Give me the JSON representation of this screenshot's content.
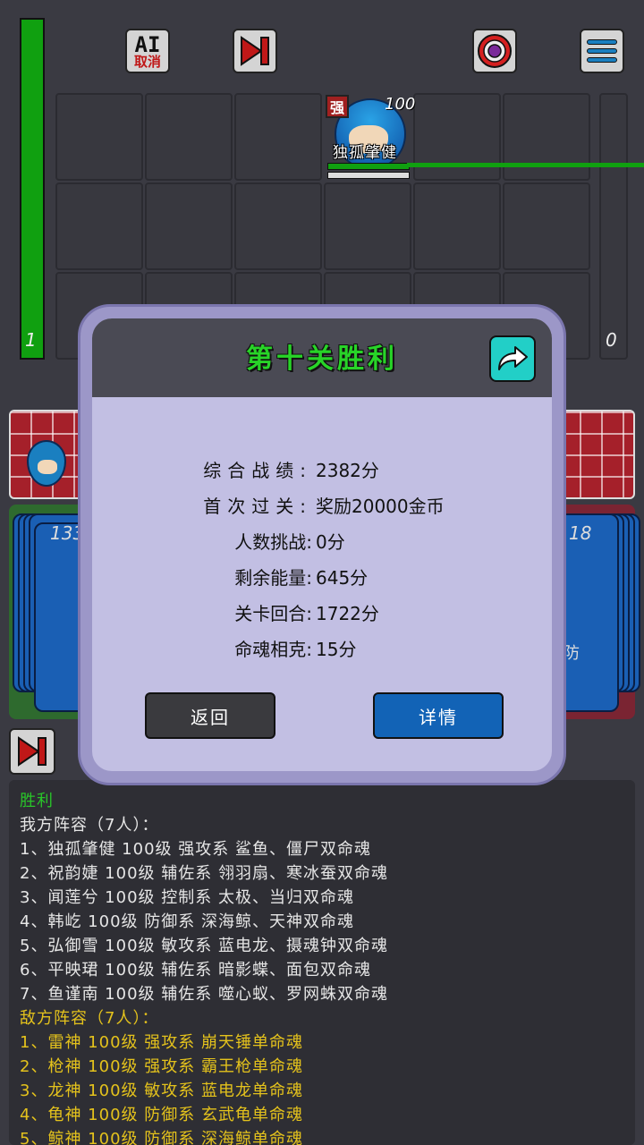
{
  "top": {
    "left_energy_value": "1",
    "right_energy_value": "0",
    "ai_button": {
      "line1": "AI",
      "line2": "取消"
    }
  },
  "hero": {
    "badge": "强",
    "level": "100",
    "name": "独孤肇健"
  },
  "decks": {
    "left_count": "133",
    "right_count": "18",
    "right_peek_text": "防"
  },
  "modal": {
    "title": "第十关胜利",
    "rows": [
      {
        "label": "综合战绩:",
        "value": "2382分"
      },
      {
        "label": "首次过关:",
        "value": "奖励20000金币"
      },
      {
        "label": "人数挑战:",
        "value": "0分"
      },
      {
        "label": "剩余能量:",
        "value": "645分"
      },
      {
        "label": "关卡回合:",
        "value": "1722分"
      },
      {
        "label": "命魂相克:",
        "value": "15分"
      }
    ],
    "back_label": "返回",
    "detail_label": "详情"
  },
  "log": {
    "lines": [
      {
        "text": "胜利",
        "color": "green"
      },
      {
        "text": "我方阵容（7人）：",
        "color": "white"
      },
      {
        "text": "1、独孤肇健 100级 强攻系 鲨鱼、僵尸双命魂",
        "color": "white"
      },
      {
        "text": "2、祝韵婕 100级 辅佐系 翎羽扇、寒冰蚕双命魂",
        "color": "white"
      },
      {
        "text": "3、闻莲兮 100级 控制系 太极、当归双命魂",
        "color": "white"
      },
      {
        "text": "4、韩屹 100级 防御系 深海鲸、天神双命魂",
        "color": "white"
      },
      {
        "text": "5、弘御雪 100级 敏攻系 蓝电龙、摄魂钟双命魂",
        "color": "white"
      },
      {
        "text": "6、平映珺 100级 辅佐系 暗影蝶、面包双命魂",
        "color": "white"
      },
      {
        "text": "7、鱼谨南 100级 辅佐系 噬心蚁、罗网蛛双命魂",
        "color": "white"
      },
      {
        "text": "敌方阵容（7人）：",
        "color": "yellow"
      },
      {
        "text": "1、雷神 100级 强攻系 崩天锤单命魂",
        "color": "yellow"
      },
      {
        "text": "2、枪神 100级 强攻系 霸王枪单命魂",
        "color": "yellow"
      },
      {
        "text": "3、龙神 100级 敏攻系 蓝电龙单命魂",
        "color": "yellow"
      },
      {
        "text": "4、龟神 100级 防御系 玄武龟单命魂",
        "color": "yellow"
      },
      {
        "text": "5、鲸神 100级 防御系 深海鲸单命魂",
        "color": "yellow"
      }
    ]
  },
  "colors": {
    "background": "#3a3a42",
    "energy_green": "#10a010",
    "modal_frame": "#9c97c8",
    "modal_body": "#c2bfe3",
    "title_green": "#28d428",
    "share_teal": "#22cfc7",
    "detail_blue": "#1263b6",
    "log_green": "#29c429",
    "log_yellow": "#e4c21c"
  }
}
